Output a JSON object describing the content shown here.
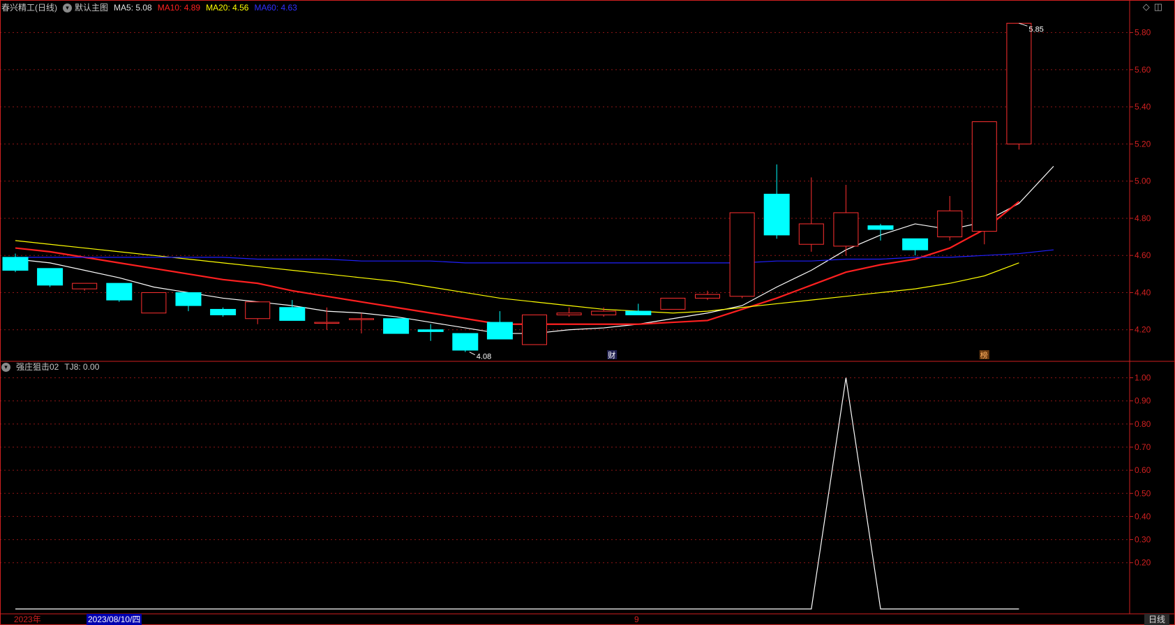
{
  "header": {
    "stock_name": "春兴精工(日线)",
    "chart_mode": "默认主图",
    "ma5": "MA5: 5.08",
    "ma10": "MA10: 4.89",
    "ma20": "MA20: 4.56",
    "ma60": "MA60: 4.63"
  },
  "indicator_header": {
    "name": "强庄狙击02",
    "value": "TJ8: 0.00"
  },
  "footer": {
    "year": "2023年",
    "cursor_date": "2023/08/10/四",
    "month_mark": "9",
    "period": "日线"
  },
  "chart_data": [
    {
      "type": "candlestick",
      "ylim": [
        4.03,
        5.9
      ],
      "yticks": [
        "5.80",
        "5.60",
        "5.40",
        "5.20",
        "5.00",
        "4.80",
        "4.60",
        "4.40",
        "4.20"
      ],
      "annotations": {
        "high": "5.85",
        "low": "4.08",
        "event_cai": "财",
        "event_bang": "榜"
      },
      "ohlc": [
        [
          4.59,
          4.61,
          4.51,
          4.52
        ],
        [
          4.53,
          4.53,
          4.43,
          4.44
        ],
        [
          4.42,
          4.45,
          4.41,
          4.45
        ],
        [
          4.45,
          4.45,
          4.35,
          4.36
        ],
        [
          4.29,
          4.4,
          4.29,
          4.4
        ],
        [
          4.4,
          4.4,
          4.3,
          4.33
        ],
        [
          4.31,
          4.32,
          4.27,
          4.28
        ],
        [
          4.26,
          4.35,
          4.23,
          4.35
        ],
        [
          4.32,
          4.36,
          4.25,
          4.25
        ],
        [
          4.24,
          4.32,
          4.2,
          4.24
        ],
        [
          4.26,
          4.29,
          4.18,
          4.26
        ],
        [
          4.26,
          4.26,
          4.18,
          4.18
        ],
        [
          4.2,
          4.23,
          4.14,
          4.19
        ],
        [
          4.18,
          4.18,
          4.08,
          4.09
        ],
        [
          4.24,
          4.3,
          4.15,
          4.15
        ],
        [
          4.12,
          4.28,
          4.12,
          4.28
        ],
        [
          4.28,
          4.32,
          4.27,
          4.29
        ],
        [
          4.28,
          4.32,
          4.27,
          4.3
        ],
        [
          4.3,
          4.34,
          4.28,
          4.28
        ],
        [
          4.31,
          4.37,
          4.31,
          4.37
        ],
        [
          4.37,
          4.41,
          4.36,
          4.39
        ],
        [
          4.38,
          4.83,
          4.37,
          4.83
        ],
        [
          4.93,
          5.09,
          4.69,
          4.71
        ],
        [
          4.66,
          5.02,
          4.62,
          4.77
        ],
        [
          4.65,
          4.98,
          4.6,
          4.83
        ],
        [
          4.76,
          4.77,
          4.68,
          4.74
        ],
        [
          4.69,
          4.69,
          4.6,
          4.63
        ],
        [
          4.7,
          4.92,
          4.68,
          4.84
        ],
        [
          4.73,
          5.32,
          4.66,
          5.32
        ],
        [
          5.2,
          5.85,
          5.17,
          5.85
        ]
      ],
      "series": [
        {
          "name": "MA5",
          "color": "#ffffff",
          "values": [
            4.58,
            4.56,
            4.52,
            4.48,
            4.43,
            4.4,
            4.37,
            4.35,
            4.33,
            4.3,
            4.29,
            4.27,
            4.24,
            4.21,
            4.18,
            4.18,
            4.2,
            4.21,
            4.23,
            4.26,
            4.29,
            4.33,
            4.43,
            4.52,
            4.63,
            4.71,
            4.77,
            4.74,
            4.78,
            4.88,
            5.08
          ]
        },
        {
          "name": "MA10",
          "color": "#ff2020",
          "values": [
            4.64,
            4.62,
            4.59,
            4.56,
            4.53,
            4.5,
            4.47,
            4.45,
            4.41,
            4.38,
            4.35,
            4.32,
            4.29,
            4.26,
            4.23,
            4.23,
            4.23,
            4.23,
            4.23,
            4.24,
            4.25,
            4.31,
            4.37,
            4.44,
            4.51,
            4.55,
            4.58,
            4.64,
            4.74,
            4.89
          ]
        },
        {
          "name": "MA20",
          "color": "#ffff00",
          "values": [
            4.68,
            4.66,
            4.64,
            4.62,
            4.6,
            4.58,
            4.56,
            4.54,
            4.52,
            4.5,
            4.48,
            4.46,
            4.43,
            4.4,
            4.37,
            4.35,
            4.33,
            4.31,
            4.3,
            4.29,
            4.3,
            4.32,
            4.34,
            4.36,
            4.38,
            4.4,
            4.42,
            4.45,
            4.49,
            4.56
          ]
        },
        {
          "name": "MA60",
          "color": "#2020ff",
          "values": [
            4.59,
            4.59,
            4.59,
            4.59,
            4.59,
            4.59,
            4.59,
            4.58,
            4.58,
            4.58,
            4.57,
            4.57,
            4.57,
            4.56,
            4.56,
            4.56,
            4.56,
            4.56,
            4.56,
            4.56,
            4.56,
            4.56,
            4.57,
            4.57,
            4.58,
            4.58,
            4.59,
            4.59,
            4.6,
            4.61,
            4.63
          ]
        }
      ]
    },
    {
      "type": "line",
      "name": "TJ8",
      "color": "#ffffff",
      "ylim": [
        0,
        1.05
      ],
      "yticks": [
        "1.00",
        "0.90",
        "0.80",
        "0.70",
        "0.60",
        "0.50",
        "0.40",
        "0.30",
        "0.20"
      ],
      "values": [
        0,
        0,
        0,
        0,
        0,
        0,
        0,
        0,
        0,
        0,
        0,
        0,
        0,
        0,
        0,
        0,
        0,
        0,
        0,
        0,
        0,
        0,
        0,
        0,
        1,
        0,
        0,
        0,
        0,
        0
      ]
    }
  ]
}
